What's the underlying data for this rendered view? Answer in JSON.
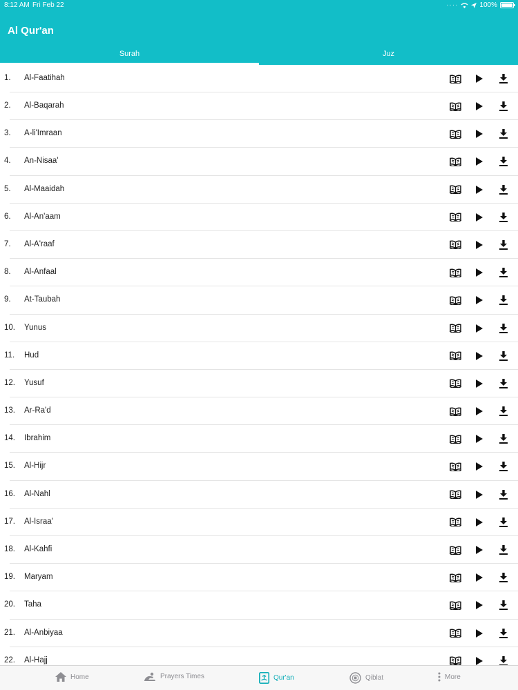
{
  "status": {
    "time": "8:12 AM",
    "date": "Fri Feb 22",
    "battery": "100%"
  },
  "app": {
    "title": "Al Qur'an"
  },
  "tabs": [
    {
      "label": "Surah",
      "active": true
    },
    {
      "label": "Juz",
      "active": false
    }
  ],
  "surahs": [
    {
      "num": "1.",
      "name": "Al-Faatihah"
    },
    {
      "num": "2.",
      "name": "Al-Baqarah"
    },
    {
      "num": "3.",
      "name": "A-li'Imraan"
    },
    {
      "num": "4.",
      "name": "An-Nisaa'"
    },
    {
      "num": "5.",
      "name": "Al-Maaidah"
    },
    {
      "num": "6.",
      "name": "Al-An'aam"
    },
    {
      "num": "7.",
      "name": "Al-A'raaf"
    },
    {
      "num": "8.",
      "name": "Al-Anfaal"
    },
    {
      "num": "9.",
      "name": "At-Taubah"
    },
    {
      "num": "10.",
      "name": "Yunus"
    },
    {
      "num": "11.",
      "name": "Hud"
    },
    {
      "num": "12.",
      "name": "Yusuf"
    },
    {
      "num": "13.",
      "name": "Ar-Ra'd"
    },
    {
      "num": "14.",
      "name": "Ibrahim"
    },
    {
      "num": "15.",
      "name": "Al-Hijr"
    },
    {
      "num": "16.",
      "name": "Al-Nahl"
    },
    {
      "num": "17.",
      "name": "Al-Israa'"
    },
    {
      "num": "18.",
      "name": "Al-Kahfi"
    },
    {
      "num": "19.",
      "name": "Maryam"
    },
    {
      "num": "20.",
      "name": "Taha"
    },
    {
      "num": "21.",
      "name": "Al-Anbiyaa"
    },
    {
      "num": "22.",
      "name": "Al-Hajj"
    }
  ],
  "row_icons": [
    "open-book-icon",
    "play-icon",
    "download-icon"
  ],
  "tabbar": [
    {
      "label": "Home",
      "icon": "home-icon",
      "active": false
    },
    {
      "label": "Prayers Times",
      "icon": "prayer-mat-icon",
      "active": false
    },
    {
      "label": "Qur'an",
      "icon": "quran-icon",
      "active": true
    },
    {
      "label": "Qiblat",
      "icon": "compass-icon",
      "active": false
    },
    {
      "label": "More",
      "icon": "more-dots-icon",
      "active": false
    }
  ],
  "colors": {
    "accent": "#12bec8",
    "tab_active": "#12aeb8",
    "tab_inactive": "#8e8e93"
  }
}
